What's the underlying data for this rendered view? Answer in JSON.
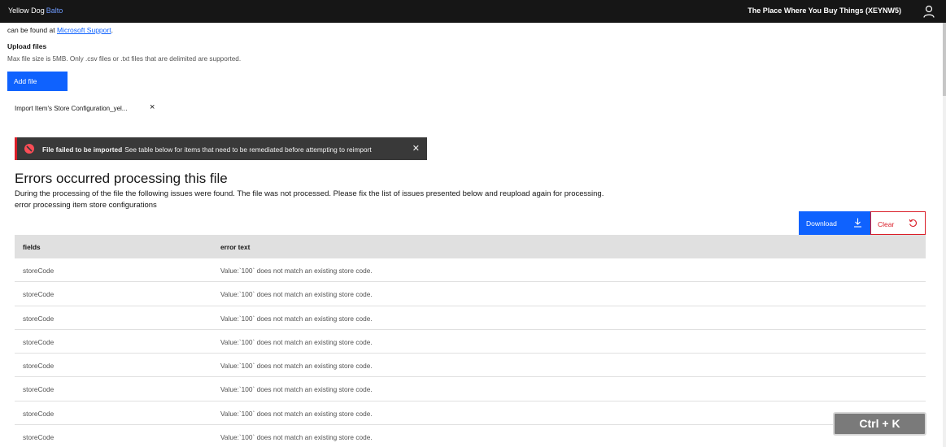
{
  "header": {
    "brand_primary": "Yellow Dog",
    "brand_secondary": "Balto",
    "store_name": "The Place Where You Buy Things (XEYNW5)",
    "user_icon": "user-icon"
  },
  "support": {
    "prefix": "can be found at ",
    "link_text": "Microsoft Support",
    "suffix": "."
  },
  "upload": {
    "title": "Upload files",
    "help_text": "Max file size is 5MB. Only .csv files or .txt files that are delimited are supported.",
    "add_file_label": "Add file",
    "file_name": "Import Item's Store Configuration_yel...",
    "file_remove_glyph": "×"
  },
  "toast": {
    "kind": "error",
    "title": "File failed to be imported",
    "message": "See table below for items that need to be remediated before attempting to reimport",
    "close_glyph": "✕"
  },
  "errors": {
    "title": "Errors occurred processing this file",
    "description": "During the processing of the file the following issues were found. The file was not processed. Please fix the list of issues presented below and reupload again for processing.",
    "subtitle": "error processing item store configurations"
  },
  "actions": {
    "download_label": "Download",
    "clear_label": "Clear"
  },
  "table": {
    "columns": [
      "fields",
      "error text"
    ],
    "rows": [
      {
        "field": "storeCode",
        "error": "Value:`100` does not match an existing store code."
      },
      {
        "field": "storeCode",
        "error": "Value:`100` does not match an existing store code."
      },
      {
        "field": "storeCode",
        "error": "Value:`100` does not match an existing store code."
      },
      {
        "field": "storeCode",
        "error": "Value:`100` does not match an existing store code."
      },
      {
        "field": "storeCode",
        "error": "Value:`100` does not match an existing store code."
      },
      {
        "field": "storeCode",
        "error": "Value:`100` does not match an existing store code."
      },
      {
        "field": "storeCode",
        "error": "Value:`100` does not match an existing store code."
      },
      {
        "field": "storeCode",
        "error": "Value:`100` does not match an existing store code."
      }
    ]
  },
  "shortcut_overlay": "Ctrl + K",
  "colors": {
    "topbar": "#161616",
    "primary": "#0f62fe",
    "danger": "#da1e28",
    "toast_bg": "#393939",
    "table_header": "#e0e0e0"
  }
}
